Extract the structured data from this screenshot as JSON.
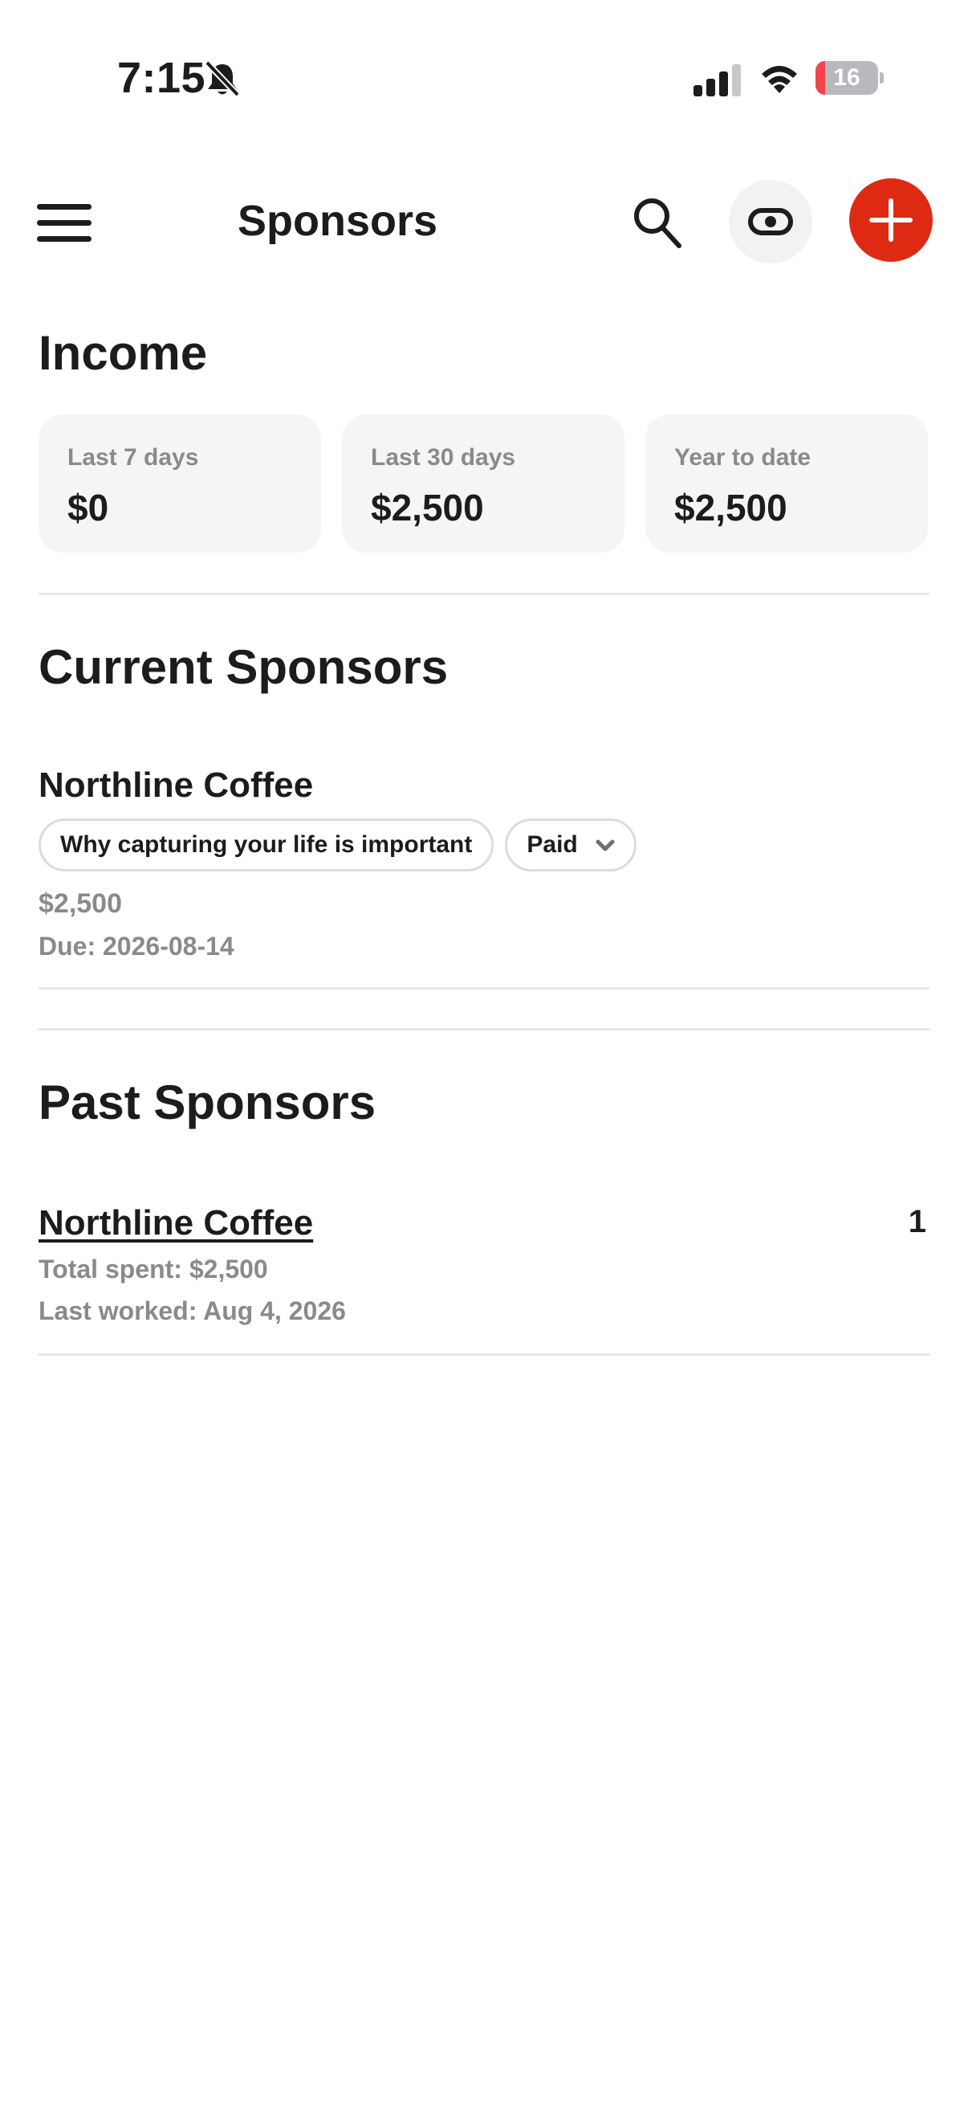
{
  "status_bar": {
    "time": "7:15",
    "battery_level": "16",
    "battery_fraction": 0.16
  },
  "header": {
    "title": "Sponsors",
    "menu_icon": "hamburger-menu-icon",
    "search_icon": "search-icon",
    "visibility_icon": "eye-icon",
    "add_icon": "plus-icon",
    "accent_color": "#de2a12"
  },
  "income": {
    "heading": "Income",
    "cards": [
      {
        "label": "Last 7 days",
        "value": "$0"
      },
      {
        "label": "Last 30 days",
        "value": "$2,500"
      },
      {
        "label": "Year to date",
        "value": "$2,500"
      }
    ]
  },
  "current_sponsors": {
    "heading": "Current Sponsors",
    "items": [
      {
        "name": "Northline Coffee",
        "video_chip": "Why capturing your life is important",
        "status": "Paid",
        "amount": "$2,500",
        "due": "Due: 2026-08-14"
      }
    ]
  },
  "past_sponsors": {
    "heading": "Past Sponsors",
    "items": [
      {
        "name": "Northline Coffee",
        "count": "1",
        "total_spent": "Total spent: $2,500",
        "last_worked": "Last worked: Aug 4, 2026"
      }
    ]
  }
}
